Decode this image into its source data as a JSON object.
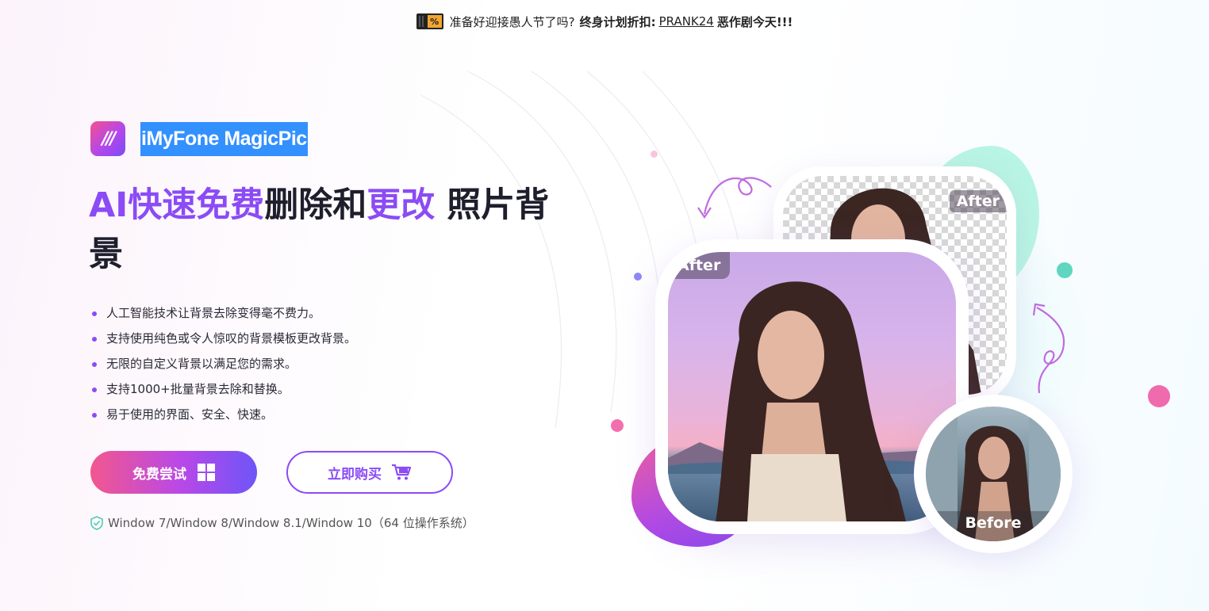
{
  "promo": {
    "text_before": "准备好迎接愚人节了吗?",
    "offer": "终身计划折扣:",
    "code": "PRANK24",
    "text_after": "恶作剧今天!!!",
    "badge": "%"
  },
  "brand": {
    "logo_text": "///",
    "name": "iMyFone MagicPic"
  },
  "headline": {
    "part1": "AI快速免费",
    "part2": "删除和",
    "part3": "更改",
    "part4": " 照片背景"
  },
  "features": [
    "人工智能技术让背景去除变得毫不费力。",
    "支持使用纯色或令人惊叹的背景模板更改背景。",
    "无限的自定义背景以满足您的需求。",
    "支持1000+批量背景去除和替换。",
    "易于使用的界面、安全、快速。"
  ],
  "buttons": {
    "trial_label": "免费尝试",
    "buy_label": "立即购买"
  },
  "os_note": "Window 7/Window 8/Window 8.1/Window 10（64 位操作系统）",
  "illustration": {
    "tag_after_back": "After",
    "tag_after_main": "After",
    "tag_before": "Before"
  },
  "colors": {
    "accent": "#8b4bf5",
    "pink": "#f2578f",
    "mint": "#5fd6c0",
    "brand_highlight": "#3390ff"
  }
}
